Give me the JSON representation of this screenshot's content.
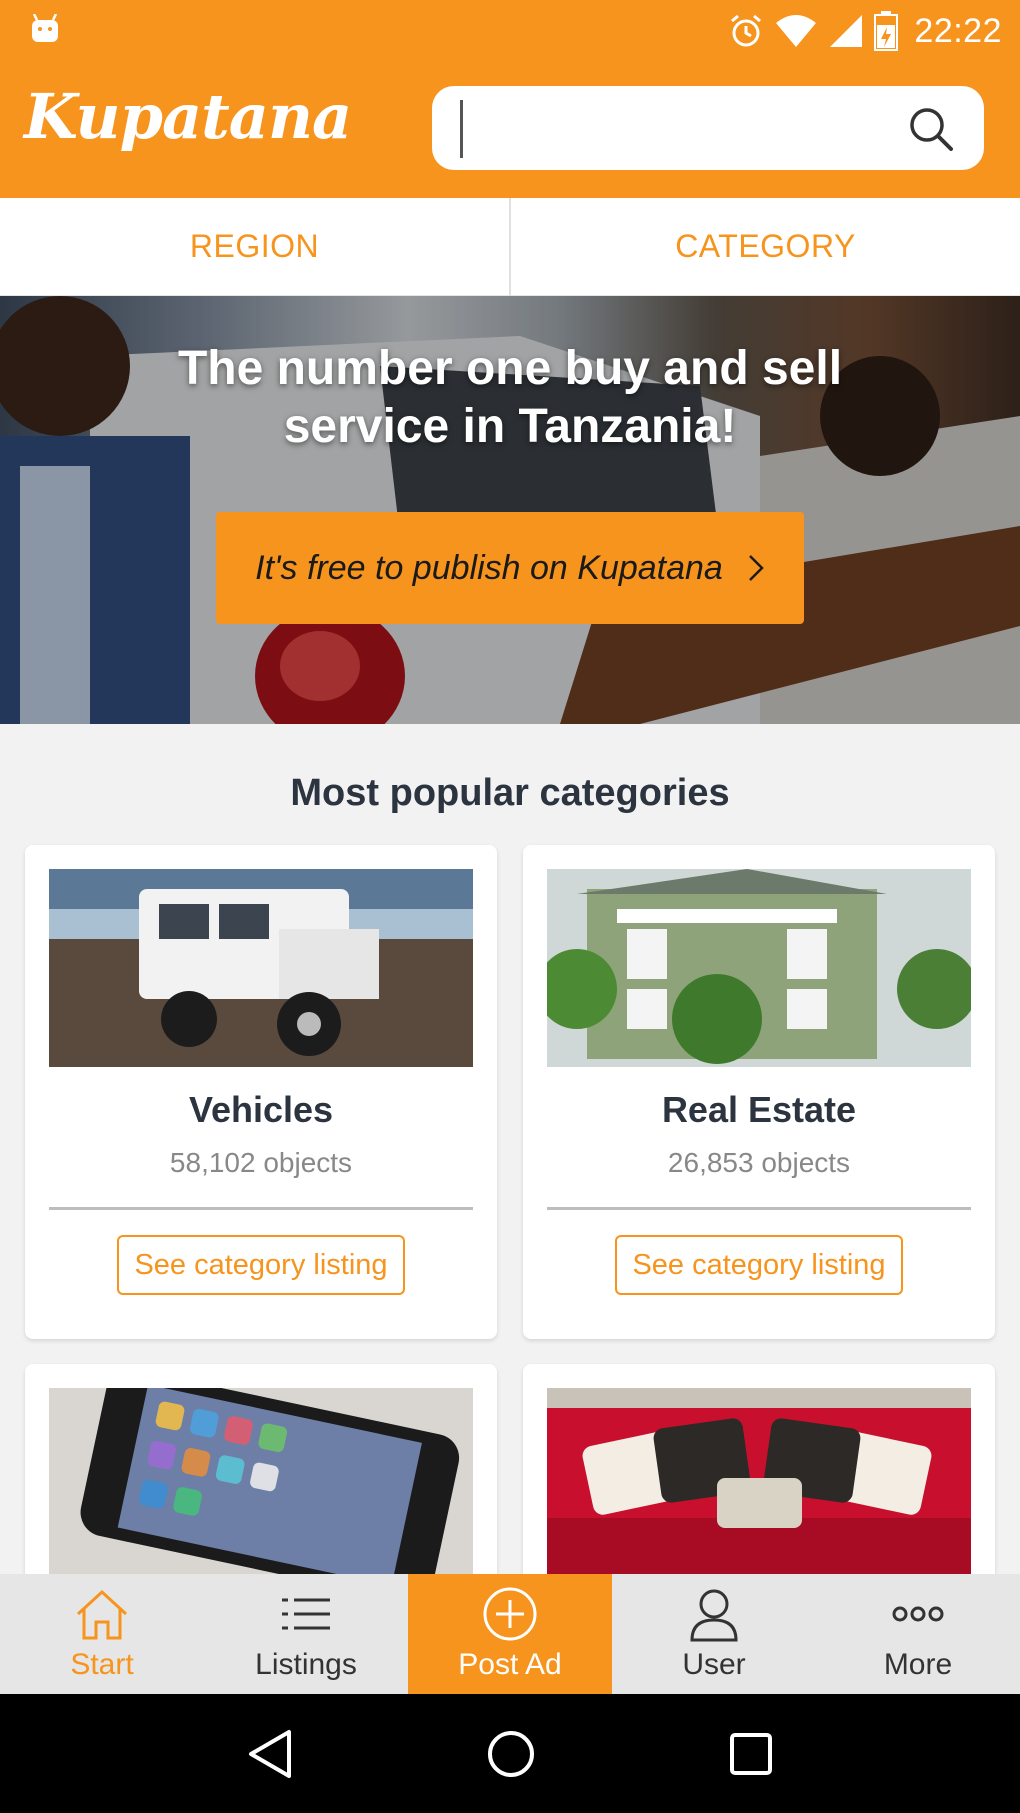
{
  "status_bar": {
    "time": "22:22",
    "icons": [
      "android-icon",
      "alarm-icon",
      "wifi-icon",
      "signal-icon",
      "battery-icon"
    ]
  },
  "header": {
    "logo": "Kupatana",
    "search": {
      "value": "",
      "placeholder": ""
    },
    "search_icon": "search-icon"
  },
  "filters": [
    "REGION",
    "CATEGORY"
  ],
  "hero": {
    "title": "The number one buy and sell service in Tanzania!",
    "cta_label": "It's free to publish on Kupatana",
    "cta_icon": "chevron-right-icon"
  },
  "popular": {
    "title": "Most popular categories",
    "cards": [
      {
        "name": "Vehicles",
        "count": "58,102 objects",
        "button": "See category listing",
        "image": "vehicle-photo"
      },
      {
        "name": "Real Estate",
        "count": "26,853 objects",
        "button": "See category listing",
        "image": "house-photo"
      },
      {
        "name": "",
        "count": "",
        "button": "",
        "image": "phone-photo"
      },
      {
        "name": "",
        "count": "",
        "button": "",
        "image": "sofa-photo"
      }
    ]
  },
  "bottom_nav": [
    {
      "label": "Start",
      "icon": "home-icon",
      "active": true
    },
    {
      "label": "Listings",
      "icon": "list-icon",
      "active": false
    },
    {
      "label": "Post Ad",
      "icon": "plus-circle-icon",
      "active": false
    },
    {
      "label": "User",
      "icon": "user-icon",
      "active": false
    },
    {
      "label": "More",
      "icon": "more-icon",
      "active": false
    }
  ],
  "system_nav": [
    "back-icon",
    "home-circle-icon",
    "recents-icon"
  ],
  "colors": {
    "brand": "#f7941d",
    "text_dark": "#2c3440",
    "muted": "#888888"
  }
}
